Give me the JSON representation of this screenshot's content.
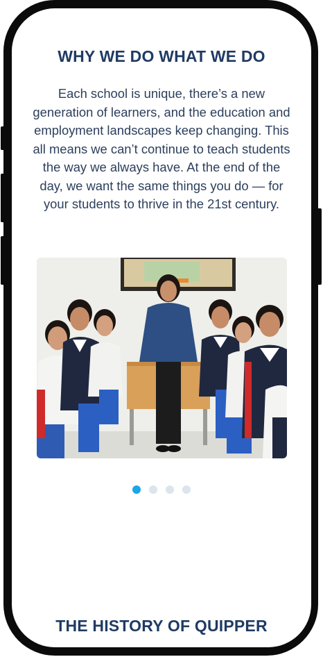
{
  "section": {
    "title": "WHY WE DO WHAT WE DO",
    "paragraph": "Each school is unique, there’s a new generation of learners, and the education and employment landscapes keep changing. This all means we can’t continue to teach students the way we always have. At the end of the day, we want the same things you do — for your students to thrive in the 21st century."
  },
  "carousel": {
    "slide_count": 4,
    "active_index": 0,
    "active_color": "#1aa6e8",
    "inactive_color": "#dce4ee"
  },
  "next_section": {
    "title": "THE HISTORY OF QUIPPER"
  },
  "colors": {
    "heading": "#1f3b63",
    "body_text": "#2c3f5c"
  }
}
